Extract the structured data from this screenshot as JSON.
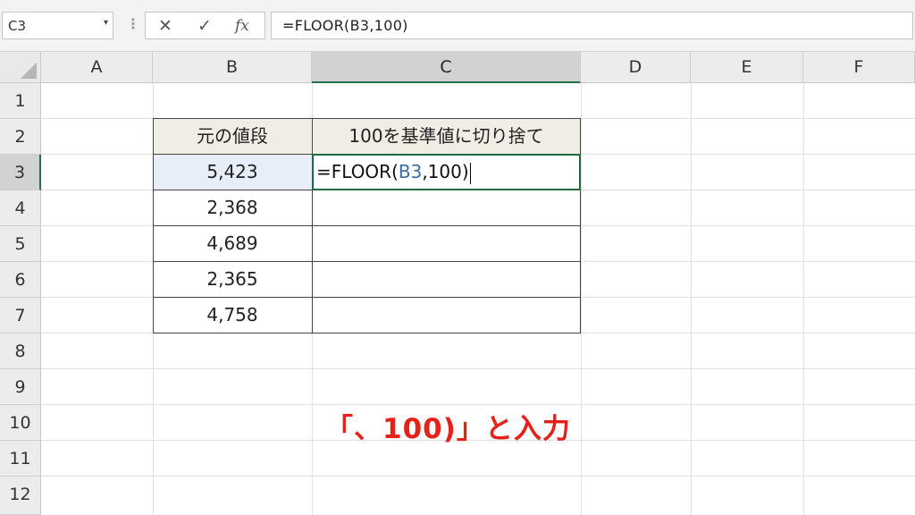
{
  "formula_bar": {
    "name_box": "C3",
    "name_box_arrow": "▾",
    "separator": "⋮",
    "cancel_icon": "✕",
    "enter_icon": "✓",
    "function_icon": "fx",
    "formula": "=FLOOR(B3,100)"
  },
  "columns": [
    "A",
    "B",
    "C",
    "D",
    "E",
    "F"
  ],
  "rows": [
    "1",
    "2",
    "3",
    "4",
    "5",
    "6",
    "7",
    "8",
    "9",
    "10",
    "11",
    "12"
  ],
  "table": {
    "headers": [
      "元の値段",
      "100を基準値に切り捨て"
    ],
    "values": [
      "5,423",
      "2,368",
      "4,689",
      "2,365",
      "4,758"
    ]
  },
  "editing": {
    "prefix": "=FLOOR(",
    "ref": "B3",
    "suffix": ",100)"
  },
  "annotation": "「、100)」と入力",
  "colors": {
    "accent_green": "#217346",
    "header_fill": "#efede4",
    "selected_fill": "#e8eef9",
    "annotation_red": "#e8201a",
    "ref_blue": "#3a6ea5"
  }
}
